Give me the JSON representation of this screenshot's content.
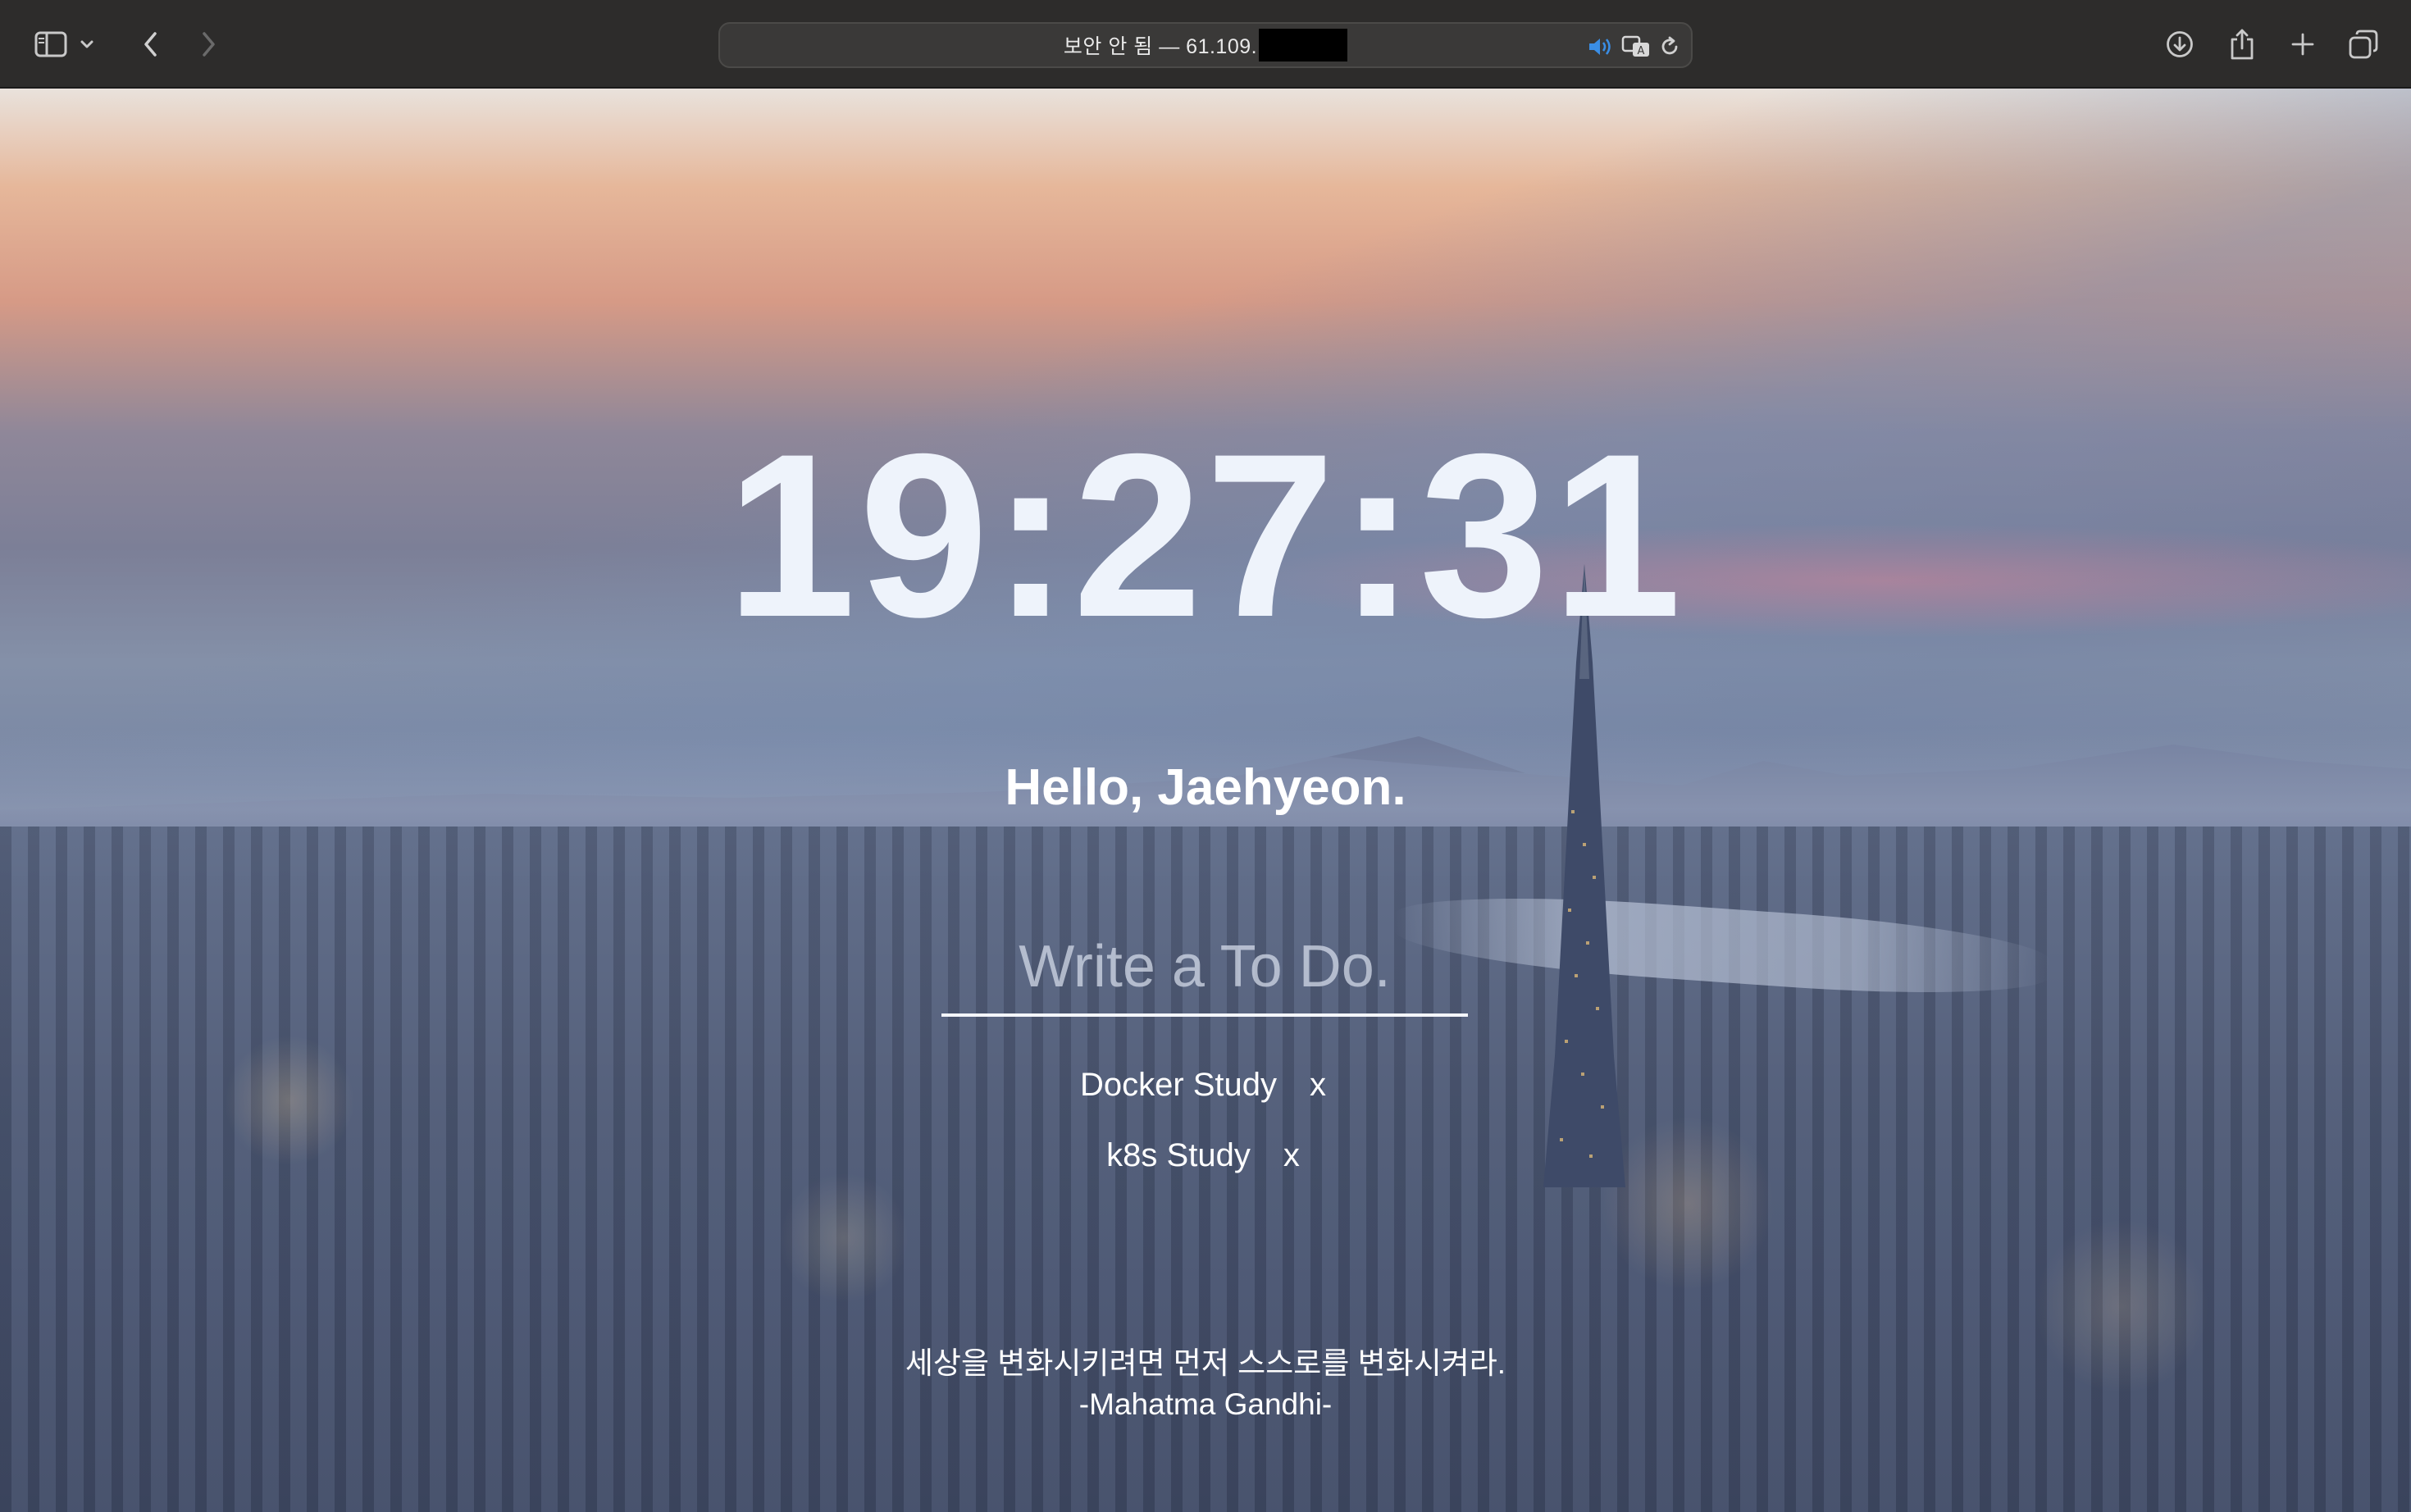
{
  "browser": {
    "address_bar": {
      "prefix": "보안 안 됨 — 61.109.",
      "redacted": true
    },
    "icons": {
      "sidebar": "sidebar-icon",
      "tab_group_menu": "chevron-down-icon",
      "back": "chevron-left-icon",
      "forward": "chevron-right-icon",
      "audio": "speaker-icon",
      "translate": "translate-icon",
      "reload": "reload-icon",
      "downloads": "download-icon",
      "share": "share-icon",
      "new_tab": "plus-icon",
      "tab_overview": "tabs-icon"
    }
  },
  "page": {
    "clock": "19:27:31",
    "greeting": "Hello, Jaehyeon.",
    "todo_input": {
      "placeholder": "Write a To Do.",
      "value": ""
    },
    "todos": [
      {
        "text": "Docker Study",
        "delete_label": "x"
      },
      {
        "text": "k8s Study",
        "delete_label": "x"
      }
    ],
    "quote": {
      "text": "세상을 변화시키려면 먼저 스스로를 변화시켜라.",
      "author": "-Mahatma Gandhi-"
    },
    "background": "Seoul city skyline at dusk"
  },
  "colors": {
    "toolbar_bg": "#2d2c2b",
    "clock_text": "#eef3fb",
    "audio_icon": "#3a8ee6"
  }
}
